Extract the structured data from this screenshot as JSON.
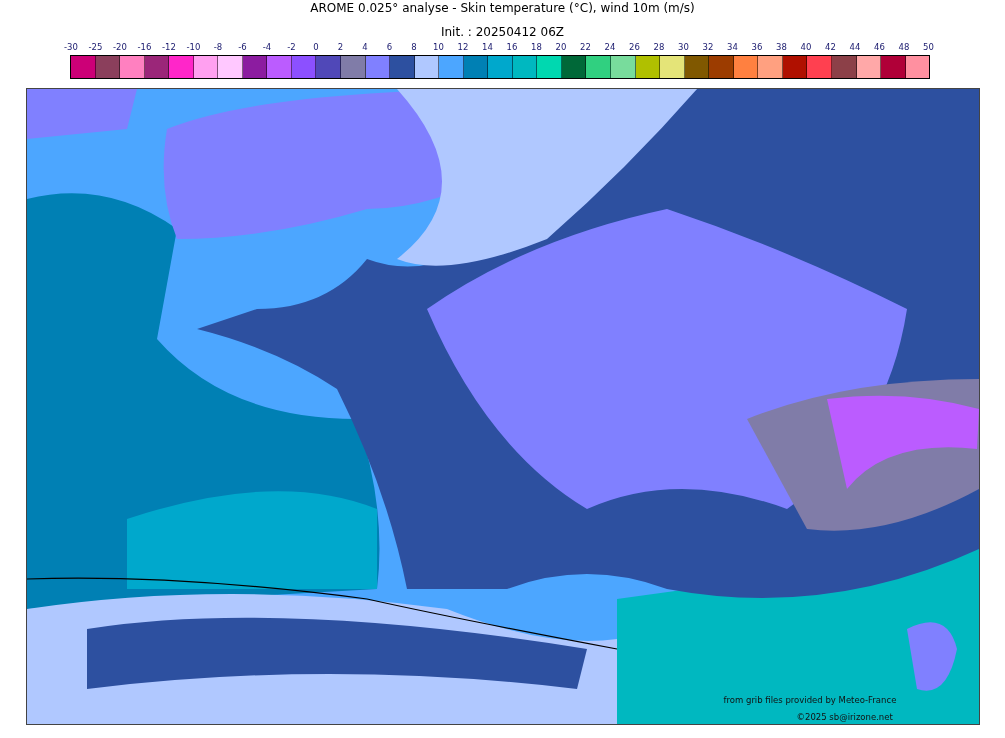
{
  "title": "AROME 0.025° analyse - Skin temperature (°C), wind 10m (m/s)",
  "subtitle": "Init. : 20250412 06Z",
  "colorbar": {
    "labels": [
      "-30",
      "-25",
      "-20",
      "-16",
      "-12",
      "-10",
      "-8",
      "-6",
      "-4",
      "-2",
      "0",
      "2",
      "4",
      "6",
      "8",
      "10",
      "12",
      "14",
      "16",
      "18",
      "20",
      "22",
      "24",
      "26",
      "28",
      "30",
      "32",
      "34",
      "36",
      "38",
      "40",
      "42",
      "44",
      "46",
      "48",
      "50"
    ],
    "cells": [
      {
        "color": "#cc0077"
      },
      {
        "color": "#8b3f5c"
      },
      {
        "color": "#ff80c0"
      },
      {
        "color": "#9b2679"
      },
      {
        "color": "#ff26c9"
      },
      {
        "color": "#ffa0f0"
      },
      {
        "color": "#ffc8ff"
      },
      {
        "color": "#8c1ca0"
      },
      {
        "color": "#bb5cff"
      },
      {
        "color": "#8c50ff"
      },
      {
        "color": "#5048b8"
      },
      {
        "color": "#807ca8"
      },
      {
        "color": "#8080ff"
      },
      {
        "color": "#2d50a0"
      },
      {
        "color": "#b0c8ff"
      },
      {
        "color": "#4ca6ff"
      },
      {
        "color": "#0080b4"
      },
      {
        "color": "#00a8cc"
      },
      {
        "color": "#00b8c0"
      },
      {
        "color": "#00d8b0"
      },
      {
        "color": "#006838"
      },
      {
        "color": "#30d080"
      },
      {
        "color": "#78dc9c"
      },
      {
        "color": "#b0c000"
      },
      {
        "color": "#e4e478"
      },
      {
        "color": "#805800"
      },
      {
        "color": "#9c3c00"
      },
      {
        "color": "#ff8040"
      },
      {
        "color": "#ffa080"
      },
      {
        "color": "#b01000"
      },
      {
        "color": "#ff4050"
      },
      {
        "color": "#8c4048"
      },
      {
        "color": "#ffa8a8"
      },
      {
        "color": "#b00038"
      },
      {
        "color": "#ff90a0"
      }
    ]
  },
  "map": {
    "credits": [
      "from grib files provided by Meteo-France",
      "©2025 sb@irizone.net"
    ]
  }
}
